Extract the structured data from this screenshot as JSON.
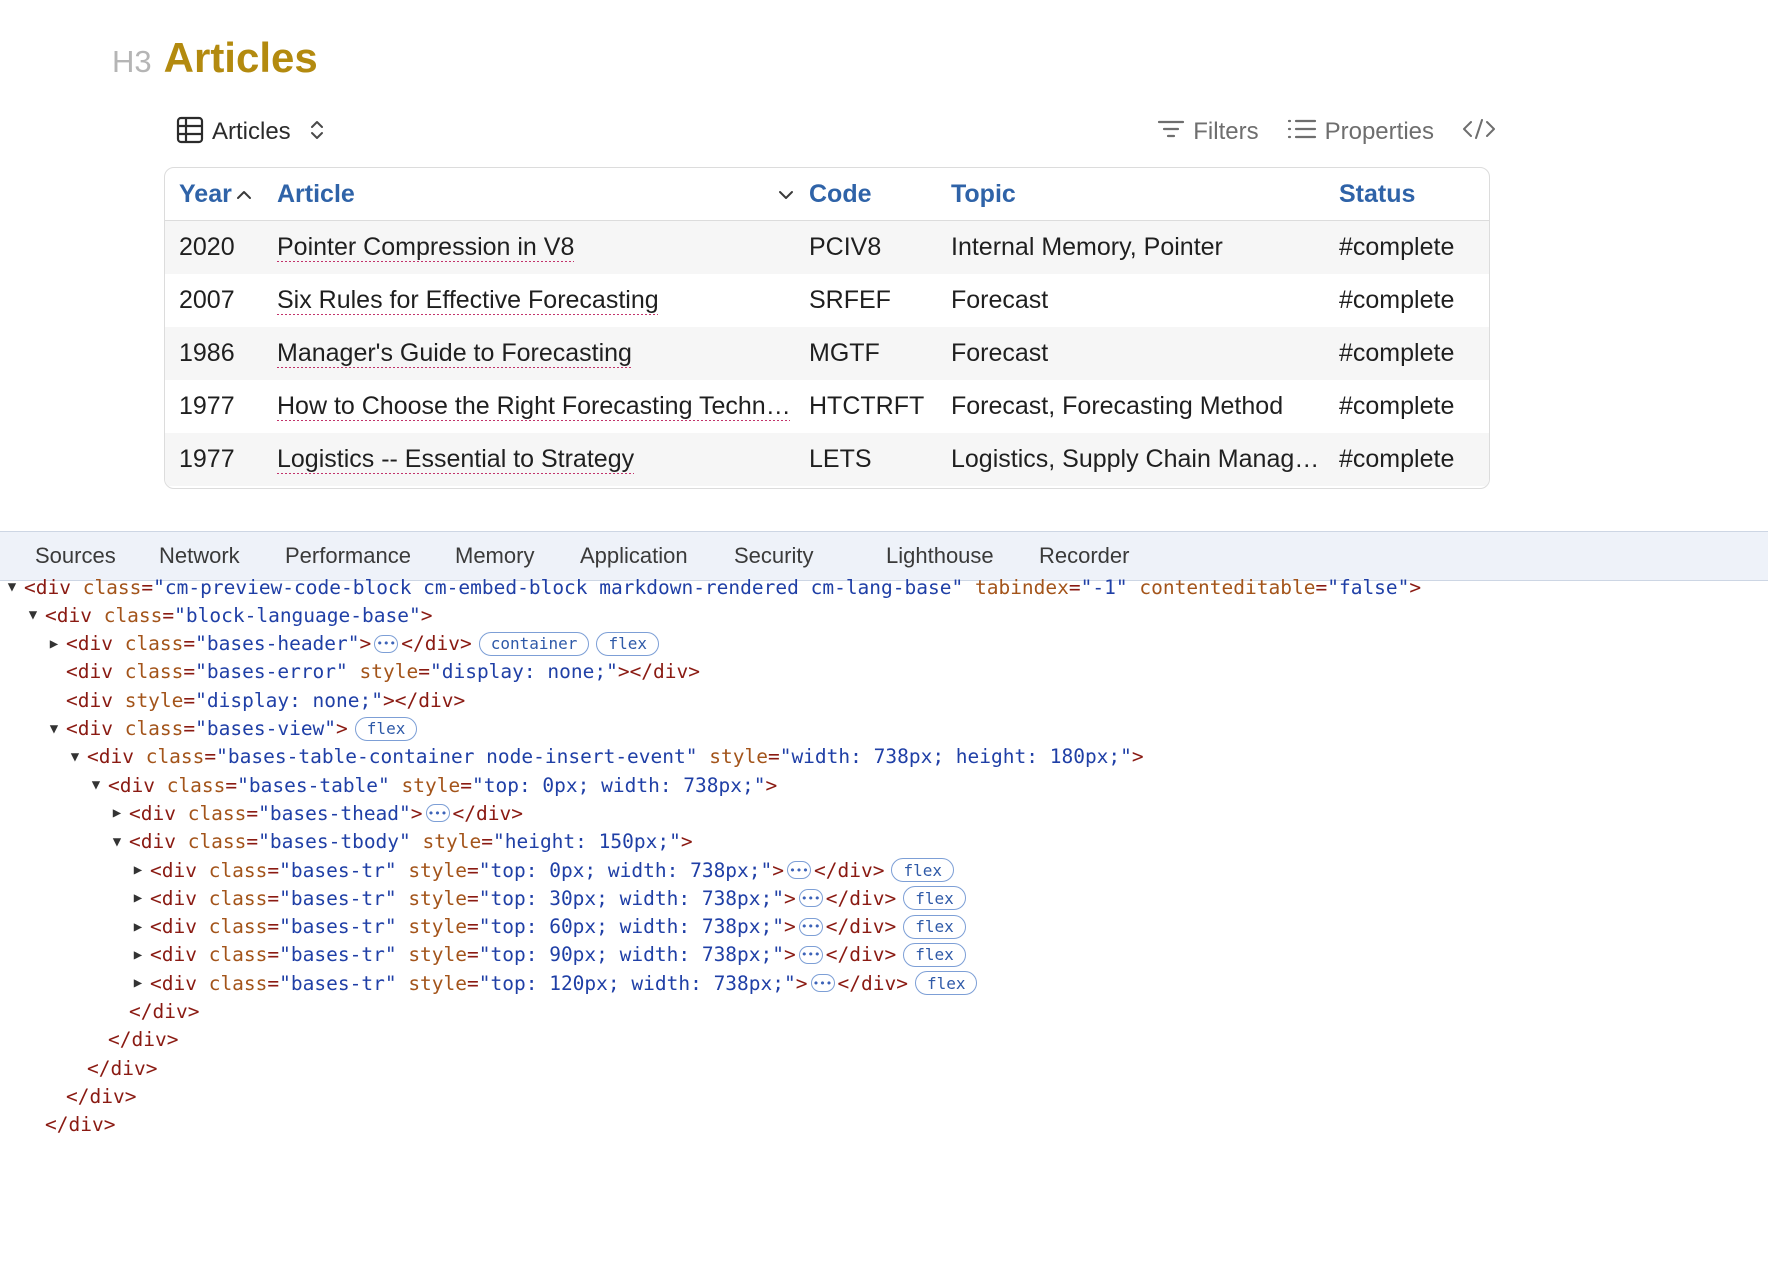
{
  "heading": {
    "level": "H3",
    "text": "Articles"
  },
  "bases_header": {
    "view_name": "Articles",
    "filters_label": "Filters",
    "properties_label": "Properties"
  },
  "table": {
    "columns": [
      "Year",
      "Article",
      "Code",
      "Topic",
      "Status"
    ],
    "sorted_column": "Year",
    "rows": [
      {
        "year": "2020",
        "article": "Pointer Compression in V8",
        "code": "PCIV8",
        "topic": "Internal Memory, Pointer",
        "status": "#complete"
      },
      {
        "year": "2007",
        "article": "Six Rules for Effective Forecasting",
        "code": "SRFEF",
        "topic": "Forecast",
        "status": "#complete"
      },
      {
        "year": "1986",
        "article": "Manager's Guide to Forecasting",
        "code": "MGTF",
        "topic": "Forecast",
        "status": "#complete"
      },
      {
        "year": "1977",
        "article": "How to Choose the Right Forecasting Techn…",
        "code": "HTCTRFT",
        "topic": "Forecast, Forecasting Method",
        "status": "#complete"
      },
      {
        "year": "1977",
        "article": "Logistics -- Essential to Strategy",
        "code": "LETS",
        "topic": "Logistics, Supply Chain Manag…",
        "status": "#complete"
      }
    ]
  },
  "devtools": {
    "tabs": [
      "Sources",
      "Network",
      "Performance",
      "Memory",
      "Application",
      "Security",
      "Lighthouse",
      "Recorder"
    ],
    "dom_lines": [
      {
        "indent": 0,
        "toggle": "open",
        "parts": [
          [
            "tag",
            "<div "
          ],
          [
            "attr",
            "class"
          ],
          [
            "eq",
            "="
          ],
          [
            "val",
            "\"cm-preview-code-block cm-embed-block markdown-rendered cm-lang-base\""
          ],
          [
            "tag",
            " "
          ],
          [
            "attr",
            "tabindex"
          ],
          [
            "eq",
            "="
          ],
          [
            "val",
            "\"-1\""
          ],
          [
            "tag",
            " "
          ],
          [
            "attr",
            "contenteditable"
          ],
          [
            "eq",
            "="
          ],
          [
            "val",
            "\"false\""
          ],
          [
            "tag",
            ">"
          ]
        ],
        "dots": false,
        "badges": []
      },
      {
        "indent": 1,
        "toggle": "open",
        "parts": [
          [
            "tag",
            "<div "
          ],
          [
            "attr",
            "class"
          ],
          [
            "eq",
            "="
          ],
          [
            "val",
            "\"block-language-base\""
          ],
          [
            "tag",
            ">"
          ]
        ],
        "dots": false,
        "badges": []
      },
      {
        "indent": 2,
        "toggle": "closed",
        "parts": [
          [
            "tag",
            "<div "
          ],
          [
            "attr",
            "class"
          ],
          [
            "eq",
            "="
          ],
          [
            "val",
            "\"bases-header\""
          ],
          [
            "tag",
            ">"
          ]
        ],
        "dots": true,
        "close": "</div>",
        "badges": [
          "container",
          "flex"
        ]
      },
      {
        "indent": 2,
        "toggle": "none",
        "parts": [
          [
            "tag",
            "<div "
          ],
          [
            "attr",
            "class"
          ],
          [
            "eq",
            "="
          ],
          [
            "val",
            "\"bases-error\""
          ],
          [
            "tag",
            " "
          ],
          [
            "attr",
            "style"
          ],
          [
            "eq",
            "="
          ],
          [
            "val",
            "\"display: none;\""
          ],
          [
            "tag",
            "></div>"
          ]
        ],
        "dots": false,
        "badges": []
      },
      {
        "indent": 2,
        "toggle": "none",
        "parts": [
          [
            "tag",
            "<div "
          ],
          [
            "attr",
            "style"
          ],
          [
            "eq",
            "="
          ],
          [
            "val",
            "\"display: none;\""
          ],
          [
            "tag",
            "></div>"
          ]
        ],
        "dots": false,
        "badges": []
      },
      {
        "indent": 2,
        "toggle": "open",
        "parts": [
          [
            "tag",
            "<div "
          ],
          [
            "attr",
            "class"
          ],
          [
            "eq",
            "="
          ],
          [
            "val",
            "\"bases-view\""
          ],
          [
            "tag",
            ">"
          ]
        ],
        "dots": false,
        "badges": [
          "flex"
        ]
      },
      {
        "indent": 3,
        "toggle": "open",
        "parts": [
          [
            "tag",
            "<div "
          ],
          [
            "attr",
            "class"
          ],
          [
            "eq",
            "="
          ],
          [
            "val",
            "\"bases-table-container node-insert-event\""
          ],
          [
            "tag",
            " "
          ],
          [
            "attr",
            "style"
          ],
          [
            "eq",
            "="
          ],
          [
            "val",
            "\"width: 738px; height: 180px;\""
          ],
          [
            "tag",
            ">"
          ]
        ],
        "dots": false,
        "badges": []
      },
      {
        "indent": 4,
        "toggle": "open",
        "parts": [
          [
            "tag",
            "<div "
          ],
          [
            "attr",
            "class"
          ],
          [
            "eq",
            "="
          ],
          [
            "val",
            "\"bases-table\""
          ],
          [
            "tag",
            " "
          ],
          [
            "attr",
            "style"
          ],
          [
            "eq",
            "="
          ],
          [
            "val",
            "\"top: 0px; width: 738px;\""
          ],
          [
            "tag",
            ">"
          ]
        ],
        "dots": false,
        "badges": []
      },
      {
        "indent": 5,
        "toggle": "closed",
        "parts": [
          [
            "tag",
            "<div "
          ],
          [
            "attr",
            "class"
          ],
          [
            "eq",
            "="
          ],
          [
            "val",
            "\"bases-thead\""
          ],
          [
            "tag",
            ">"
          ]
        ],
        "dots": true,
        "close": "</div>",
        "badges": []
      },
      {
        "indent": 5,
        "toggle": "open",
        "parts": [
          [
            "tag",
            "<div "
          ],
          [
            "attr",
            "class"
          ],
          [
            "eq",
            "="
          ],
          [
            "val",
            "\"bases-tbody\""
          ],
          [
            "tag",
            " "
          ],
          [
            "attr",
            "style"
          ],
          [
            "eq",
            "="
          ],
          [
            "val",
            "\"height: 150px;\""
          ],
          [
            "tag",
            ">"
          ]
        ],
        "dots": false,
        "badges": []
      },
      {
        "indent": 6,
        "toggle": "closed",
        "parts": [
          [
            "tag",
            "<div "
          ],
          [
            "attr",
            "class"
          ],
          [
            "eq",
            "="
          ],
          [
            "val",
            "\"bases-tr\""
          ],
          [
            "tag",
            " "
          ],
          [
            "attr",
            "style"
          ],
          [
            "eq",
            "="
          ],
          [
            "val",
            "\"top: 0px; width: 738px;\""
          ],
          [
            "tag",
            ">"
          ]
        ],
        "dots": true,
        "close": "</div>",
        "badges": [
          "flex"
        ]
      },
      {
        "indent": 6,
        "toggle": "closed",
        "parts": [
          [
            "tag",
            "<div "
          ],
          [
            "attr",
            "class"
          ],
          [
            "eq",
            "="
          ],
          [
            "val",
            "\"bases-tr\""
          ],
          [
            "tag",
            " "
          ],
          [
            "attr",
            "style"
          ],
          [
            "eq",
            "="
          ],
          [
            "val",
            "\"top: 30px; width: 738px;\""
          ],
          [
            "tag",
            ">"
          ]
        ],
        "dots": true,
        "close": "</div>",
        "badges": [
          "flex"
        ]
      },
      {
        "indent": 6,
        "toggle": "closed",
        "parts": [
          [
            "tag",
            "<div "
          ],
          [
            "attr",
            "class"
          ],
          [
            "eq",
            "="
          ],
          [
            "val",
            "\"bases-tr\""
          ],
          [
            "tag",
            " "
          ],
          [
            "attr",
            "style"
          ],
          [
            "eq",
            "="
          ],
          [
            "val",
            "\"top: 60px; width: 738px;\""
          ],
          [
            "tag",
            ">"
          ]
        ],
        "dots": true,
        "close": "</div>",
        "badges": [
          "flex"
        ]
      },
      {
        "indent": 6,
        "toggle": "closed",
        "parts": [
          [
            "tag",
            "<div "
          ],
          [
            "attr",
            "class"
          ],
          [
            "eq",
            "="
          ],
          [
            "val",
            "\"bases-tr\""
          ],
          [
            "tag",
            " "
          ],
          [
            "attr",
            "style"
          ],
          [
            "eq",
            "="
          ],
          [
            "val",
            "\"top: 90px; width: 738px;\""
          ],
          [
            "tag",
            ">"
          ]
        ],
        "dots": true,
        "close": "</div>",
        "badges": [
          "flex"
        ]
      },
      {
        "indent": 6,
        "toggle": "closed",
        "parts": [
          [
            "tag",
            "<div "
          ],
          [
            "attr",
            "class"
          ],
          [
            "eq",
            "="
          ],
          [
            "val",
            "\"bases-tr\""
          ],
          [
            "tag",
            " "
          ],
          [
            "attr",
            "style"
          ],
          [
            "eq",
            "="
          ],
          [
            "val",
            "\"top: 120px; width: 738px;\""
          ],
          [
            "tag",
            ">"
          ]
        ],
        "dots": true,
        "close": "</div>",
        "badges": [
          "flex"
        ]
      },
      {
        "indent": 5,
        "toggle": "none",
        "parts": [
          [
            "tag",
            "</div>"
          ]
        ],
        "dots": false,
        "badges": []
      },
      {
        "indent": 4,
        "toggle": "none",
        "parts": [
          [
            "tag",
            "</div>"
          ]
        ],
        "dots": false,
        "badges": []
      },
      {
        "indent": 3,
        "toggle": "none",
        "parts": [
          [
            "tag",
            "</div>"
          ]
        ],
        "dots": false,
        "badges": []
      },
      {
        "indent": 2,
        "toggle": "none",
        "parts": [
          [
            "tag",
            "</div>"
          ]
        ],
        "dots": false,
        "badges": []
      },
      {
        "indent": 1,
        "toggle": "none",
        "parts": [
          [
            "tag",
            "</div>"
          ]
        ],
        "dots": false,
        "badges": []
      }
    ]
  },
  "colors": {
    "heading": "#b38a0f",
    "column_header": "#2f63a8",
    "link_underline": "#c2336b",
    "devtools_tabbar": "#eef2f9"
  }
}
